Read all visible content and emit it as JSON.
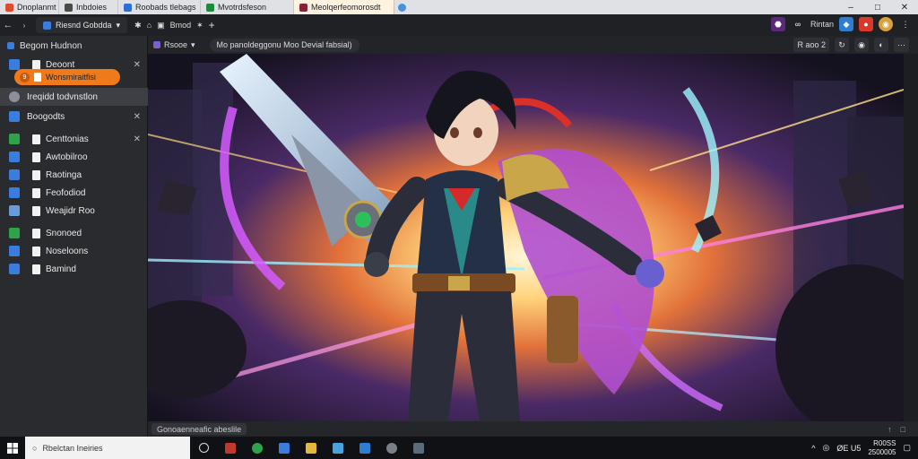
{
  "browser": {
    "tabs": [
      {
        "label": "Dnoplanmt b",
        "color": "#e04a2f",
        "active": false
      },
      {
        "label": "Inbdoies",
        "color": "#4a4a4a",
        "active": false
      },
      {
        "label": "Roobads tlebags",
        "color": "#2f6fd1",
        "active": false
      },
      {
        "label": "Mvotrdsfeson",
        "color": "#1f8a3b",
        "active": false
      },
      {
        "label": "Meolqerfeomorosdt",
        "color": "#8a1f3b",
        "active": true
      }
    ]
  },
  "toolbar": {
    "back": "←",
    "forward": "→",
    "workspace_label": "Riesnd Gobdda",
    "tool_label": "Bmod",
    "right_label": "Rintan"
  },
  "sidebar": {
    "header": "Begom Hudnon",
    "items": [
      {
        "label": "Deoont",
        "lead_color": "#3b7ddd",
        "close": true
      },
      {
        "label": "Ireqidd todvnstlon",
        "lead_color": "#8a8f99",
        "close": false,
        "selected": true
      },
      {
        "label": "Boogodts",
        "lead_color": "#3b7ddd",
        "close": true
      },
      {
        "label": "Centtonias",
        "lead_color": "#2fa34a",
        "close": true
      },
      {
        "label": "Awtobilroo",
        "lead_color": "#3b7ddd",
        "close": false
      },
      {
        "label": "Raotinga",
        "lead_color": "#3b7ddd",
        "close": false
      },
      {
        "label": "Feofodiod",
        "lead_color": "#3b7ddd",
        "close": false
      },
      {
        "label": "Weajidr Roo",
        "lead_color": "#6b9ad9",
        "close": false
      },
      {
        "label": "Snonoed",
        "lead_color": "#2fa34a",
        "close": false
      },
      {
        "label": "Noseloons",
        "lead_color": "#3b7ddd",
        "close": false
      },
      {
        "label": "Bamind",
        "lead_color": "#3b7ddd",
        "close": false
      }
    ],
    "badge": {
      "count": "9",
      "label": "Wonsmiraitfisi"
    }
  },
  "pane": {
    "tab_label": "Rsooe",
    "tab_close": "×",
    "url": "Mo panoldeggonu Moo Devial fabsial)",
    "right_buttons": [
      "R aoo 2",
      "↻",
      "◉",
      "◐",
      "⋯"
    ]
  },
  "status": {
    "left": "Gonoaenneafic abeslile",
    "right": [
      "↑",
      "□"
    ]
  },
  "taskbar": {
    "search_placeholder": "Rbelctan Ineiries",
    "tray_text": "ØE U5",
    "time": "R00SS",
    "date": "2500005"
  },
  "colors": {
    "accent_orange": "#f07a1a",
    "sidebar_bg": "#2a2b2f",
    "tabstrip_bg": "#dfe1e5"
  }
}
